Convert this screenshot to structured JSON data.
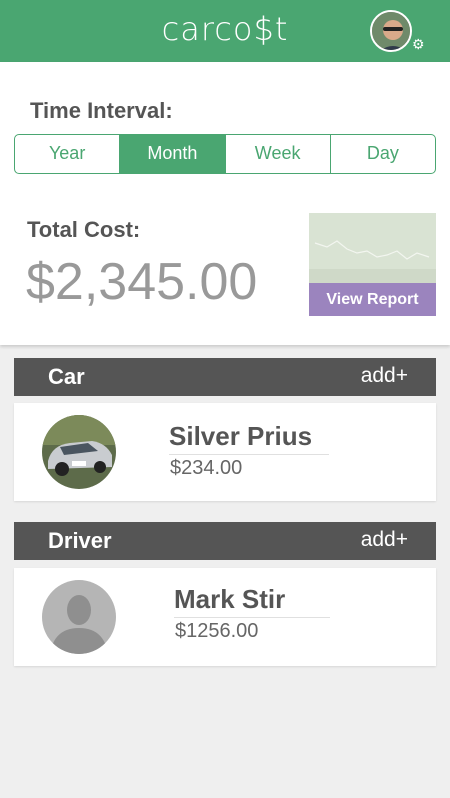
{
  "header": {
    "logo_text": "carco$t"
  },
  "time_interval": {
    "label": "Time Interval:",
    "options": [
      "Year",
      "Month",
      "Week",
      "Day"
    ],
    "selected": "Month"
  },
  "total_cost": {
    "label": "Total Cost:",
    "value": "$2,345.00"
  },
  "report": {
    "button_label": "View Report"
  },
  "car_section": {
    "title": "Car",
    "add_label": "add+",
    "item": {
      "name": "Silver Prius",
      "cost": "$234.00"
    }
  },
  "driver_section": {
    "title": "Driver",
    "add_label": "add+",
    "item": {
      "name": "Mark Stir",
      "cost": "$1256.00"
    }
  },
  "colors": {
    "brand_green": "#4aa671",
    "report_purple": "#9b84be",
    "section_dark": "#555555"
  }
}
